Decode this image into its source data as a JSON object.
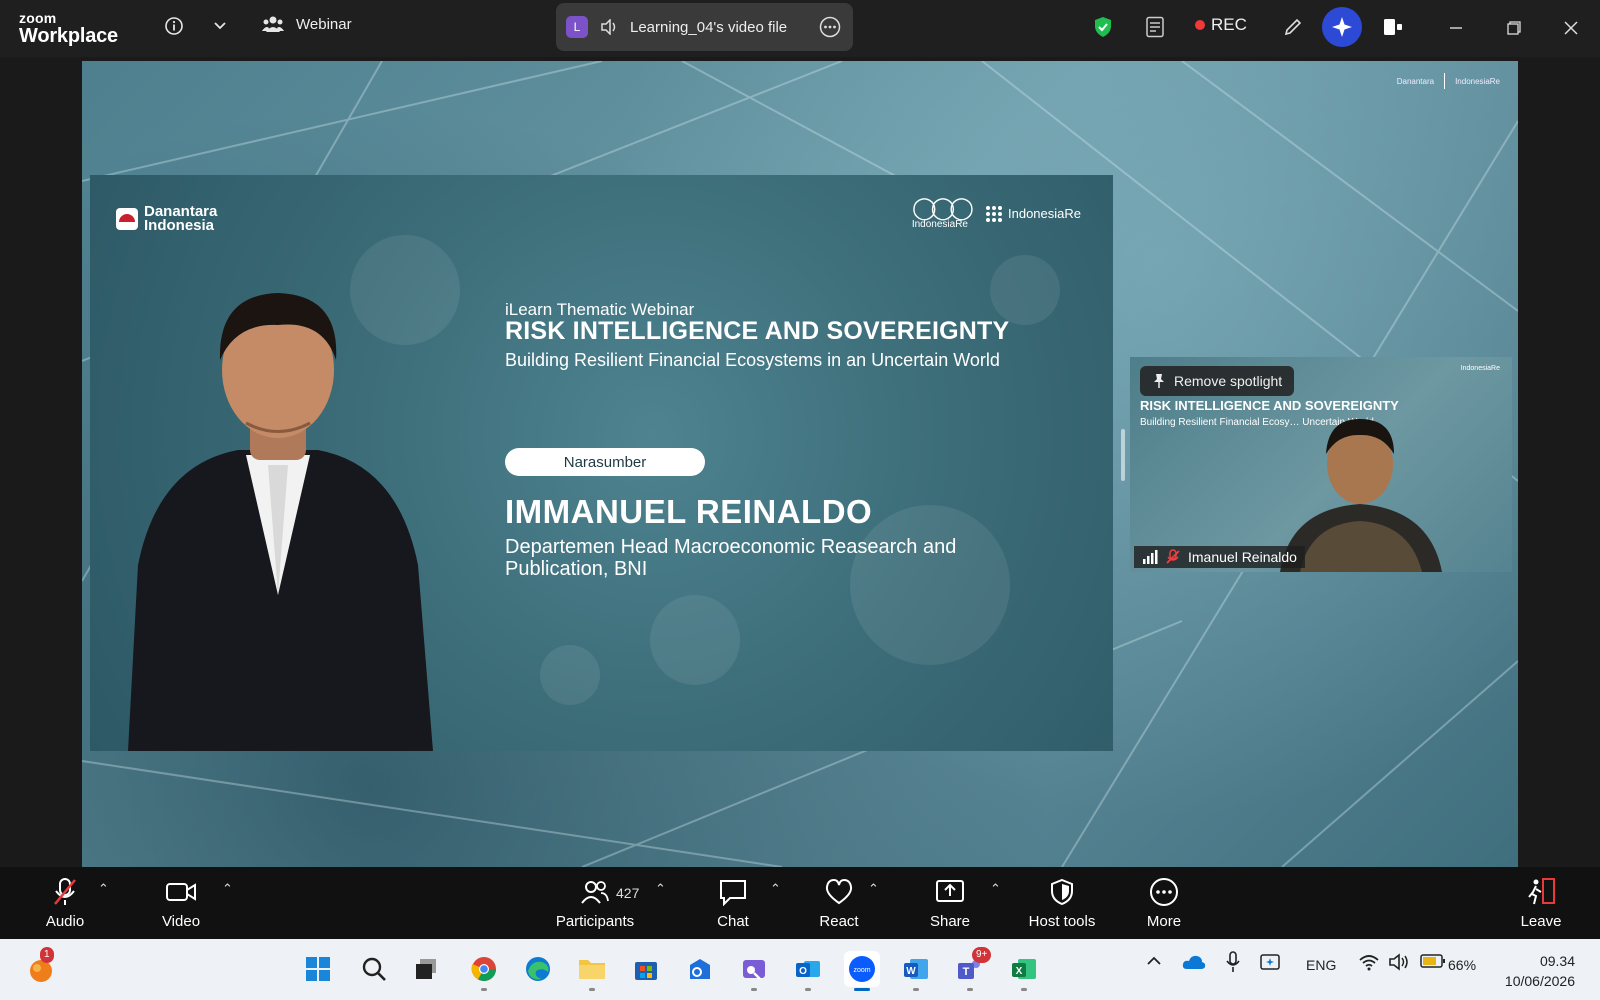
{
  "app": {
    "brand_top": "zoom",
    "brand_bottom": "Workplace",
    "mode_label": "Webinar"
  },
  "share": {
    "initial": "L",
    "title": "Learning_04's video file"
  },
  "recording": {
    "label": "REC"
  },
  "colors": {
    "accent_blue": "#0b5cff",
    "rec_red": "#f03a3a",
    "shield_green": "#1fbf4f",
    "purple": "#7b52c7"
  },
  "slide": {
    "brand_line1": "Danantara",
    "brand_line2": "Indonesia",
    "logo_ire": "IndonesiaRe",
    "logo_institute": "IndonesiaRe",
    "kicker": "iLearn Thematic Webinar",
    "title": "RISK INTELLIGENCE AND SOVEREIGNTY",
    "subtitle": "Building Resilient Financial Ecosystems in an Uncertain World",
    "role_pill": "Narasumber",
    "speaker_name": "IMMANUEL REINALDO",
    "speaker_role": "Departemen Head Macroeconomic Reasearch and Publication, BNI"
  },
  "spotlight": {
    "remove_label": "Remove spotlight",
    "title": "RISK INTELLIGENCE AND SOVEREIGNTY",
    "subtitle": "Building Resilient Financial Ecosy… Uncertain World",
    "participant_name": "Imanuel Reinaldo"
  },
  "controls": {
    "audio": "Audio",
    "video": "Video",
    "participants": "Participants",
    "participant_count": "427",
    "chat": "Chat",
    "react": "React",
    "share": "Share",
    "host_tools": "Host tools",
    "more": "More",
    "leave": "Leave"
  },
  "taskbar": {
    "notification_badge": "1",
    "teams_badge": "9+",
    "language": "ENG",
    "battery": "66%",
    "time": "09.34",
    "date": "10/06/2026"
  }
}
